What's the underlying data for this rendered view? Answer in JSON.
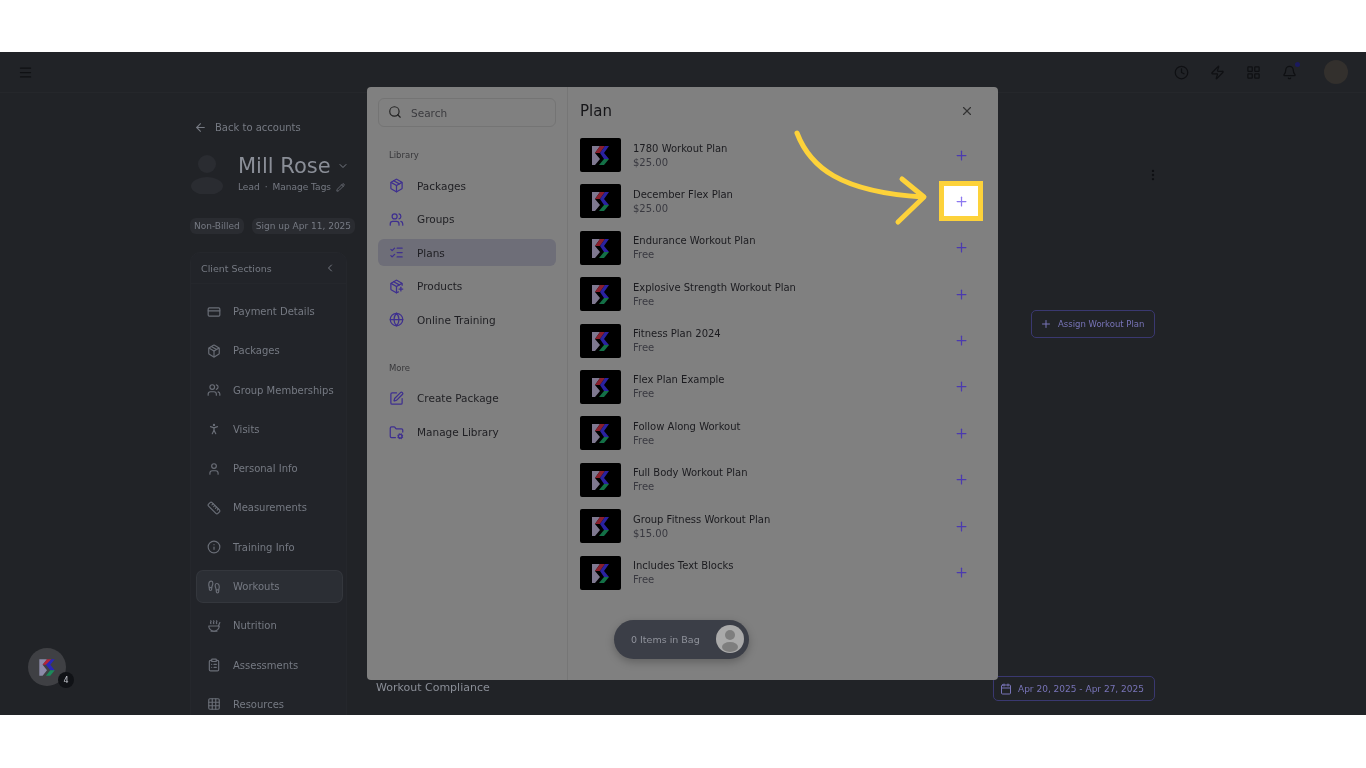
{
  "client": {
    "back_link": "Back to accounts",
    "name": "Mill Rose",
    "status": "Lead",
    "separator": "·",
    "tags_link": "Manage Tags",
    "badges": [
      "Non-Billed",
      "Sign up Apr 11, 2025"
    ]
  },
  "client_sections": {
    "title": "Client Sections",
    "items": [
      {
        "label": "Payment Details",
        "selected": false
      },
      {
        "label": "Packages",
        "selected": false
      },
      {
        "label": "Group Memberships",
        "selected": false
      },
      {
        "label": "Visits",
        "selected": false
      },
      {
        "label": "Personal Info",
        "selected": false
      },
      {
        "label": "Measurements",
        "selected": false
      },
      {
        "label": "Training Info",
        "selected": false
      },
      {
        "label": "Workouts",
        "selected": true
      },
      {
        "label": "Nutrition",
        "selected": false
      },
      {
        "label": "Assessments",
        "selected": false
      },
      {
        "label": "Resources",
        "selected": false
      }
    ]
  },
  "main": {
    "assign_button": "Assign Workout Plan",
    "compliance_title": "Workout Compliance",
    "date_range": "Apr 20, 2025 - Apr 27, 2025"
  },
  "floating_badge": {
    "count": "4"
  },
  "modal": {
    "search": {
      "placeholder": "Search"
    },
    "library_title": "Library",
    "library_items": [
      {
        "label": "Packages",
        "selected": false
      },
      {
        "label": "Groups",
        "selected": false
      },
      {
        "label": "Plans",
        "selected": true
      },
      {
        "label": "Products",
        "selected": false
      },
      {
        "label": "Online Training",
        "selected": false
      }
    ],
    "more_title": "More",
    "more_items": [
      "Create Package",
      "Manage Library"
    ],
    "title": "Plan",
    "plans": [
      {
        "name": "1780 Workout Plan",
        "price": "$25.00",
        "highlighted": false
      },
      {
        "name": "December Flex Plan",
        "price": "$25.00",
        "highlighted": true
      },
      {
        "name": "Endurance Workout Plan",
        "price": "Free",
        "highlighted": false
      },
      {
        "name": "Explosive Strength Workout Plan",
        "price": "Free",
        "highlighted": false
      },
      {
        "name": "Fitness Plan 2024",
        "price": "Free",
        "highlighted": false
      },
      {
        "name": "Flex Plan Example",
        "price": "Free",
        "highlighted": false
      },
      {
        "name": "Follow Along Workout",
        "price": "Free",
        "highlighted": false
      },
      {
        "name": "Full Body Workout Plan",
        "price": "Free",
        "highlighted": false
      },
      {
        "name": "Group Fitness Workout Plan",
        "price": "$15.00",
        "highlighted": false
      },
      {
        "name": "Includes Text Blocks",
        "price": "Free",
        "highlighted": false
      }
    ],
    "bag": "0 Items in Bag"
  }
}
